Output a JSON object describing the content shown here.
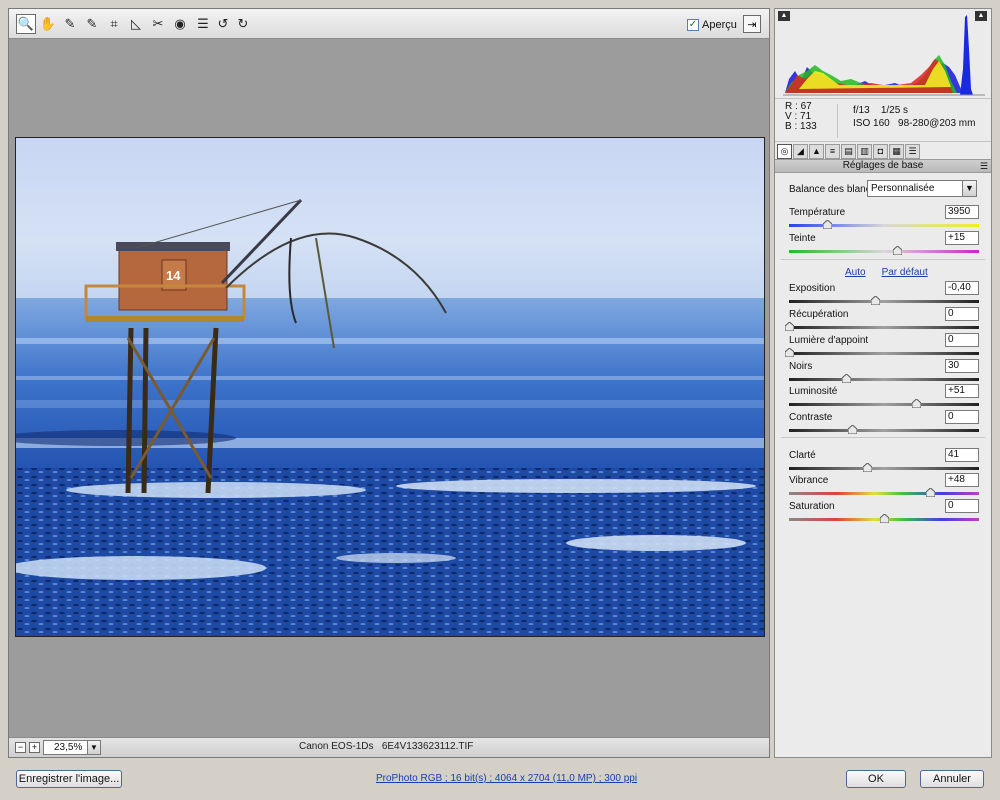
{
  "toolbar": {
    "tools": [
      {
        "name": "zoom-tool",
        "glyph": "🔍"
      },
      {
        "name": "hand-tool",
        "glyph": "✋"
      },
      {
        "name": "white-balance-tool",
        "glyph": "✎"
      },
      {
        "name": "color-sampler-tool",
        "glyph": "✎"
      },
      {
        "name": "crop-tool",
        "glyph": "⌗"
      },
      {
        "name": "straighten-tool",
        "glyph": "◺"
      },
      {
        "name": "retouch-tool",
        "glyph": "✂"
      },
      {
        "name": "red-eye-tool",
        "glyph": "◉"
      },
      {
        "name": "preferences-tool",
        "glyph": "☰"
      },
      {
        "name": "rotate-left-tool",
        "glyph": "↺"
      },
      {
        "name": "rotate-right-tool",
        "glyph": "↻"
      }
    ],
    "preview_label": "Aperçu",
    "preview_checked": true
  },
  "status": {
    "zoom": "23,5%",
    "camera": "Canon EOS-1Ds",
    "filename": "6E4V133623112.TIF"
  },
  "readout": {
    "r_label": "R :",
    "r_value": "67",
    "v_label": "V :",
    "v_value": "71",
    "b_label": "B :",
    "b_value": "133",
    "aperture": "f/13",
    "shutter": "1/25 s",
    "iso": "ISO 160",
    "lens": "98-280@203 mm"
  },
  "panel": {
    "title": "Réglages de base",
    "wb_label": "Balance des blancs :",
    "wb_value": "Personnalisée",
    "auto_label": "Auto",
    "default_label": "Par défaut"
  },
  "sliders": [
    {
      "id": "temperature",
      "label": "Température",
      "value": "3950",
      "pos": 0.2,
      "track": "temp"
    },
    {
      "id": "tint",
      "label": "Teinte",
      "value": "+15",
      "pos": 0.57,
      "track": "tint"
    },
    {
      "id": "exposure",
      "label": "Exposition",
      "value": "-0,40",
      "pos": 0.45,
      "track": "gray"
    },
    {
      "id": "recovery",
      "label": "Récupération",
      "value": "0",
      "pos": 0.0,
      "track": "gray"
    },
    {
      "id": "fill-light",
      "label": "Lumière d'appoint",
      "value": "0",
      "pos": 0.0,
      "track": "gray"
    },
    {
      "id": "blacks",
      "label": "Noirs",
      "value": "30",
      "pos": 0.3,
      "track": "gray"
    },
    {
      "id": "brightness",
      "label": "Luminosité",
      "value": "+51",
      "pos": 0.67,
      "track": "gray"
    },
    {
      "id": "contrast",
      "label": "Contraste",
      "value": "0",
      "pos": 0.33,
      "track": "gray"
    },
    {
      "id": "clarity",
      "label": "Clarté",
      "value": "41",
      "pos": 0.41,
      "track": "gray"
    },
    {
      "id": "vibrance",
      "label": "Vibrance",
      "value": "+48",
      "pos": 0.74,
      "track": "sat"
    },
    {
      "id": "saturation",
      "label": "Saturation",
      "value": "0",
      "pos": 0.5,
      "track": "sat"
    }
  ],
  "bottom": {
    "save_label": "Enregistrer l'image...",
    "workflow_label": "ProPhoto RGB ; 16 bit(s) ; 4064 x 2704 (11,0 MP) ; 300 ppi",
    "ok_label": "OK",
    "cancel_label": "Annuler"
  },
  "colors": {
    "accent": "#1a3fa8",
    "sky": "#c7d7f2",
    "sea": "#2a5fb8"
  },
  "photo": {
    "hut_number": "14"
  }
}
